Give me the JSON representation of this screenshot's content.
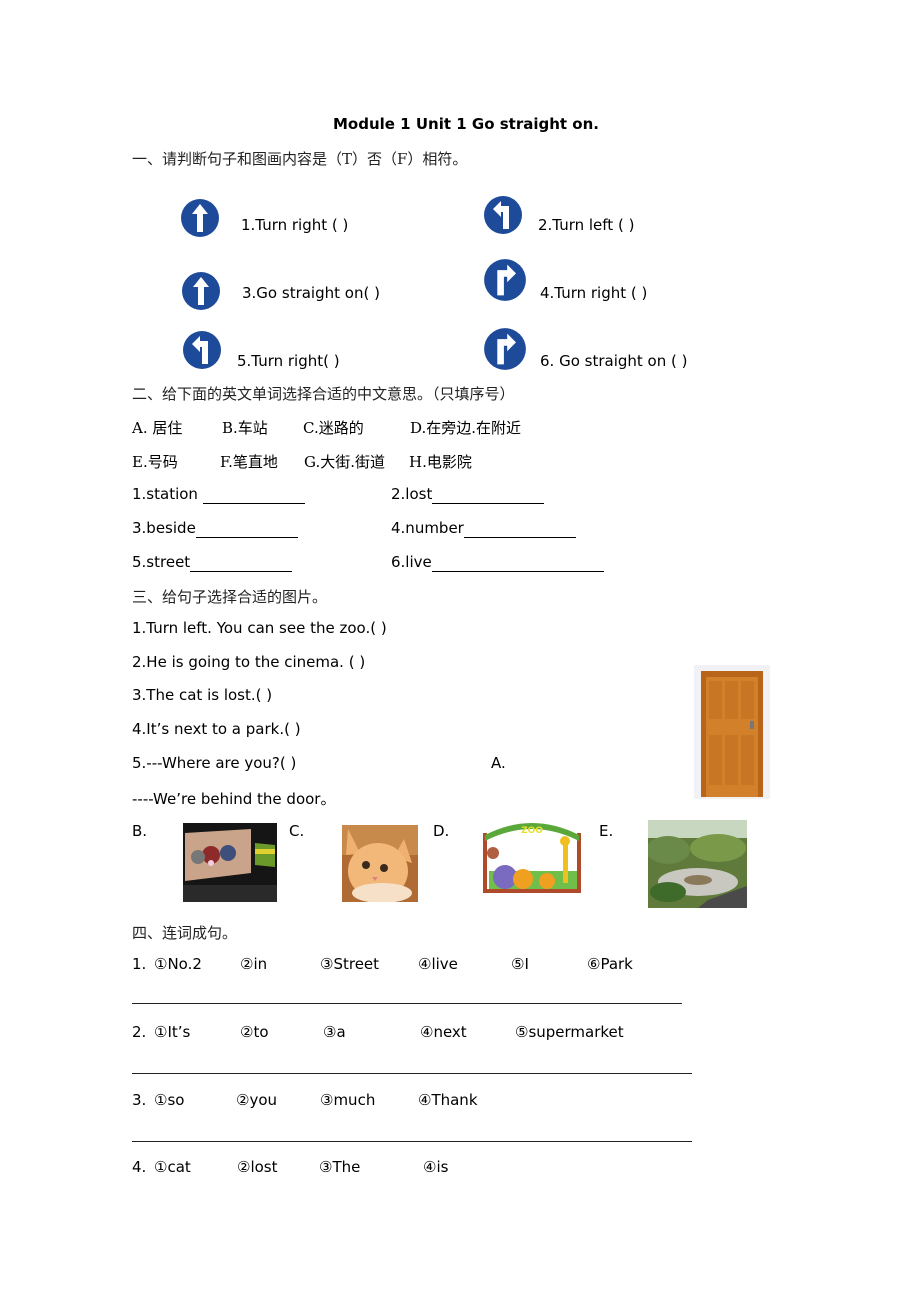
{
  "title": "Module 1 Unit 1 Go straight on.",
  "sections": {
    "s1": {
      "heading": "一、请判断句子和图画内容是（T）否（F）相符。",
      "items": [
        {
          "text": "1.Turn right  (    )",
          "sign": "arrow-up"
        },
        {
          "text": "2.Turn left  (    )",
          "sign": "arrow-turn-left"
        },
        {
          "text": "3.Go straight on(   )",
          "sign": "arrow-up"
        },
        {
          "text": "4.Turn right  (   )",
          "sign": "arrow-turn-right"
        },
        {
          "text": "5.Turn right(   )",
          "sign": "arrow-turn-left"
        },
        {
          "text": "6. Go straight on  (   )",
          "sign": "arrow-turn-right"
        }
      ]
    },
    "s2": {
      "heading": "二、给下面的英文单词选择合适的中文意思。（只填序号）",
      "options_row1": [
        "A. 居住",
        "B.车站",
        "C.迷路的",
        "D.在旁边.在附近"
      ],
      "options_row2": [
        "E.号码",
        "F.笔直地",
        "G.大街.街道",
        "H.电影院"
      ],
      "words": [
        "1.station",
        "2.lost",
        "3.beside",
        "4.number",
        "5.street",
        "6.live"
      ]
    },
    "s3": {
      "heading": "三、给句子选择合适的图片。",
      "sentences": [
        "1.Turn left. You can see the zoo.(    )",
        "2.He is going to the cinema. (    )",
        "3.The cat is lost.(    )",
        "4.It’s next to a park.(    )",
        "5.---Where are you?(    )",
        " ----We’re behind the door。"
      ],
      "pictures": [
        {
          "label": "A.",
          "subject": "door"
        },
        {
          "label": "B.",
          "subject": "cinema"
        },
        {
          "label": "C.",
          "subject": "kitten"
        },
        {
          "label": "D.",
          "subject": "zoo",
          "sign_text": "ZOO"
        },
        {
          "label": "E.",
          "subject": "park"
        }
      ]
    },
    "s4": {
      "heading": "四、连词成句。",
      "questions": [
        {
          "num": "1.",
          "words": [
            "①No.2",
            "②in",
            "③Street",
            "④live",
            "⑤I",
            "⑥Park"
          ]
        },
        {
          "num": "2.",
          "words": [
            "①It’s",
            "②to",
            "③a",
            "④next",
            "⑤supermarket"
          ]
        },
        {
          "num": "3.",
          "words": [
            "①so",
            "②you",
            "③much",
            "④Thank"
          ]
        },
        {
          "num": "4.",
          "words": [
            "①cat",
            "②lost",
            "③The",
            "④is"
          ]
        }
      ]
    }
  },
  "colors": {
    "sign_blue": "#1e4a9a",
    "door": "#c8741e",
    "zoo_green": "#5aa83a"
  }
}
